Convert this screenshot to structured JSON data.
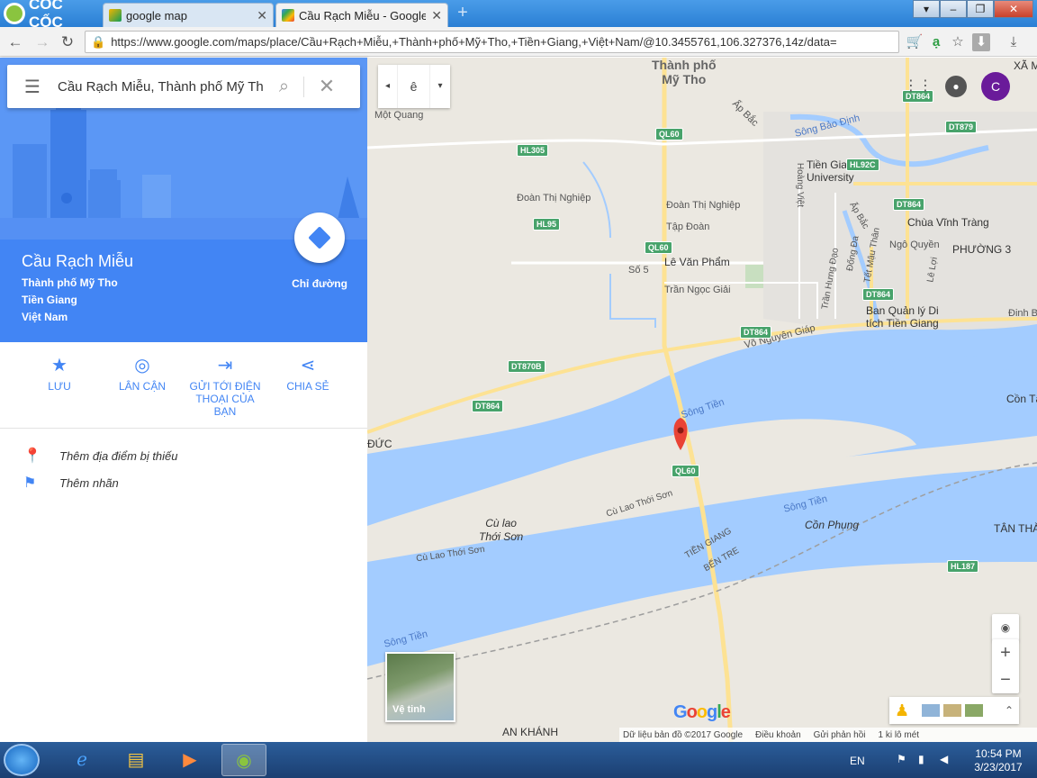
{
  "browser": {
    "brand": "CỐC CỐC",
    "tabs": [
      {
        "label": "google map",
        "active": false
      },
      {
        "label": "Cầu Rạch Miễu - Google M",
        "active": true
      }
    ],
    "url": "https://www.google.com/maps/place/Cầu+Rạch+Miễu,+Thành+phố+Mỹ+Tho,+Tiền+Giang,+Việt+Nam/@10.3455761,106.327376,14z/data="
  },
  "search": {
    "value": "Cầu Rạch Miễu, Thành phố Mỹ Th"
  },
  "place": {
    "title": "Cầu Rạch Miễu",
    "lines": [
      "Thành phố Mỹ Tho",
      "Tiền Giang",
      "Việt Nam"
    ],
    "directions_label": "Chỉ đường"
  },
  "actions": [
    {
      "label": "LƯU",
      "icon": "star-icon"
    },
    {
      "label": "LÂN CẬN",
      "icon": "nearby-icon"
    },
    {
      "label": "GỬI TỚI ĐIỆN THOẠI CỦA BẠN",
      "icon": "send-phone-icon"
    },
    {
      "label": "CHIA SẺ",
      "icon": "share-icon"
    }
  ],
  "add_rows": [
    {
      "label": "Thêm địa điểm bị thiếu",
      "icon": "add-place-icon"
    },
    {
      "label": "Thêm nhãn",
      "icon": "flag-icon"
    }
  ],
  "map": {
    "tools_letter": "ê",
    "avatar": "C",
    "labels": {
      "my_tho": "Thành phố\nMỹ Tho",
      "mot_quang": "Một Quang",
      "ap_bac": "Ấp Bắc",
      "song_bao_dinh": "Sông Bảo Định",
      "tien_giang_univ": "Tiền Giang\nUniversity",
      "doan_thi_nghiep": "Đoàn Thị Nghiệp",
      "doan_thi_nghiep2": "Đoàn Thị Nghiệp",
      "tap_doan": "Tập Đoàn",
      "le_van_pham": "Lê Văn Phẩm",
      "so5": "Số 5",
      "tran_ngoc_giai": "Trần Ngọc Giải",
      "chua_vinh_trang": "Chùa Vĩnh Tràng",
      "ngo_quyen": "Ngô Quyền",
      "phuong3": "PHƯỜNG 3",
      "ban_quan_ly": "Ban Quản lý Di\ntích Tiền Giang",
      "vo_nguyen_giap": "Võ Nguyên Giáp",
      "con_tan": "Cồn Tâ",
      "song_tien1": "Sông Tiền",
      "song_tien2": "Sông Tiền",
      "song_tien3": "Sông Tiền",
      "cu_lao_thoi_son": "Cù lao\nThới Sơn",
      "cu_lao_thoi_son_road": "Cù Lao Thới Sơn",
      "cu_lao_thoi_son_road2": "Cù Lao Thới Sơn",
      "con_phung": "Cồn Phụng",
      "tien_giang_border": "TIỀN GIANG",
      "ben_tre_border": "BẾN TRE",
      "tan_tha": "TÂN THÀ",
      "an_khanh": "AN KHÁNH",
      "duc": "ĐỨC",
      "xa_m": "XÃ M",
      "dinh_b": "Đinh B",
      "hoang_viet": "Hoàng Việt",
      "tran_hung_dao": "Trần Hưng Đạo",
      "dong_da": "Đống Đa",
      "tet_mau_than": "Tết Mậu Thân",
      "ap_bac2": "Ấp Bắc",
      "le_loi": "Lê Lợi"
    },
    "shields": {
      "ql60a": "QL60",
      "ql60b": "QL60",
      "ql60c": "QL60",
      "hl305": "HL305",
      "hl95": "HL95",
      "hl92c": "HL92C",
      "dt864a": "DT864",
      "dt864b": "DT864",
      "dt864c": "DT864",
      "dt864d": "DT864",
      "dt864e": "DT864",
      "dt879": "DT879",
      "dt870b": "DT870B",
      "hl187": "HL187"
    },
    "satellite_label": "Vệ tinh",
    "footer": [
      "Dữ liệu bản đồ ©2017 Google",
      "Điều khoản",
      "Gửi phản hồi",
      "1 ki lô mét"
    ]
  },
  "taskbar": {
    "lang": "EN",
    "time": "10:54 PM",
    "date": "3/23/2017"
  },
  "colors": {
    "accent": "#4285f4",
    "water": "#a3ccff",
    "road": "#fde293",
    "land": "#ebe8e1"
  }
}
